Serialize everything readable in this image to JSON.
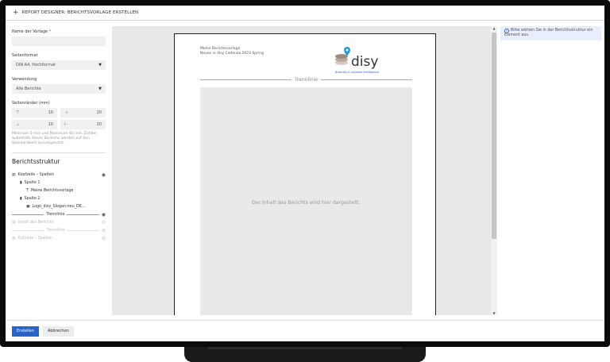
{
  "titlebar": {
    "title": "REPORT DESIGNER: BERICHTSVORLAGE ERSTELLEN"
  },
  "form": {
    "name_label": "Name der Vorlage",
    "name_required": "*",
    "name_value": "",
    "format_label": "Seitenformat",
    "format_value": "DIN A4, Hochformat",
    "usage_label": "Verwendung",
    "usage_value": "Alle Berichte",
    "margins_label": "Seitenränder (mm)",
    "margins": {
      "top": "10",
      "right": "20",
      "bottom": "10",
      "left": "20"
    },
    "margins_hint": "Minimum 5 mm und Maximum 40 mm. Zahlen außerhalb dieses Bereichs werden auf den Standardwert zurückgesetzt."
  },
  "structure": {
    "heading": "Berichtsstruktur",
    "header_row": "Kopfzeile – Spalten",
    "col1": "Spalte 1",
    "col1_item": "Meine Berichtsvorlage",
    "col2": "Spalte 2",
    "col2_item": "Logo_disy_Slogan-neu_DE...",
    "divider1": "Trennlinie",
    "content": "Inhalt des Berichts",
    "divider2": "Trennlinie",
    "footer_row": "Fußzeile – Spalten"
  },
  "page": {
    "header_line1": "Meine Berichtsvorlage",
    "header_line2": "Neues in disy Cadenza 2023 Spring",
    "logo_word": "disy",
    "logo_slogan": "Business & Location Intelligence",
    "divider": "Trennlinie",
    "content_placeholder": "Der Inhalt des Berichts wird hier dargestellt."
  },
  "info": {
    "text": "Bitte wählen Sie in der Berichtsstruktur ein Element aus."
  },
  "footer": {
    "create": "Erstellen",
    "cancel": "Abbrechen"
  },
  "colors": {
    "accent": "#2a63c7",
    "logo_pin": "#1e9ad6"
  }
}
